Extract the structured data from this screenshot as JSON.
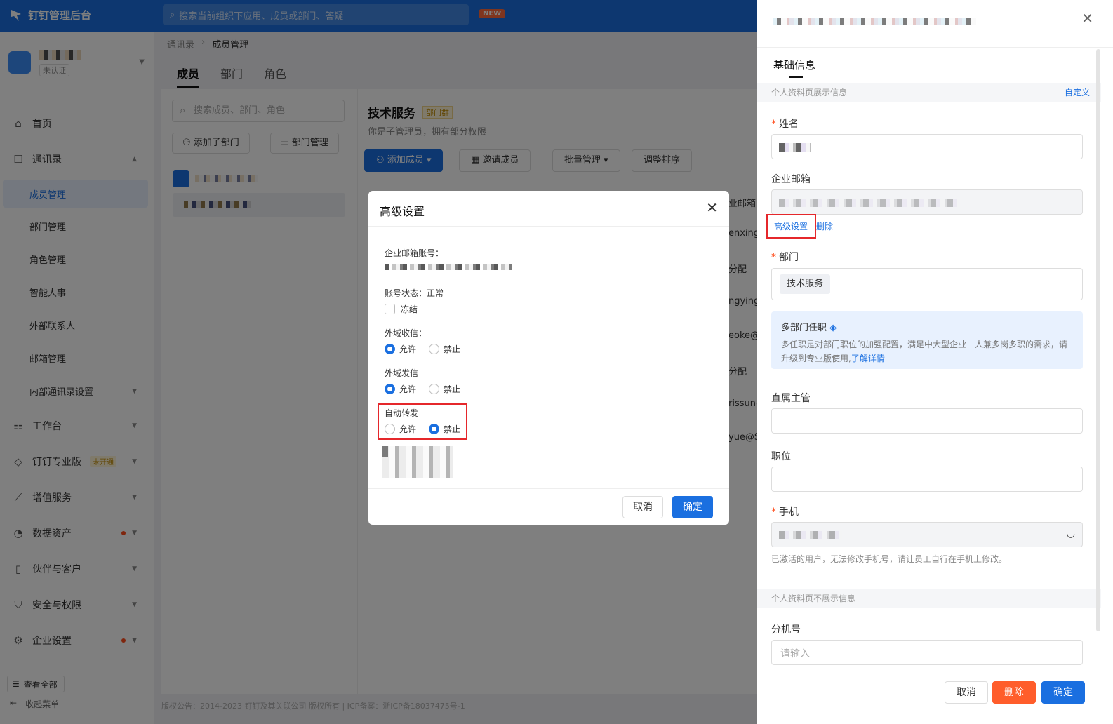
{
  "app": {
    "title": "钉钉管理后台"
  },
  "search": {
    "placeholder": "搜索当前组织下应用、成员或部门、答疑",
    "new_badge": "NEW"
  },
  "org": {
    "cert": "未认证"
  },
  "sidebar": {
    "home": "首页",
    "contacts": "通讯录",
    "contacts_sub": [
      "成员管理",
      "部门管理",
      "角色管理",
      "智能人事",
      "外部联系人",
      "邮箱管理",
      "内部通讯录设置"
    ],
    "sections": [
      {
        "label": "工作台"
      },
      {
        "label": "钉钉专业版",
        "tag": "未开通"
      },
      {
        "label": "增值服务"
      },
      {
        "label": "数据资产"
      },
      {
        "label": "伙伴与客户"
      },
      {
        "label": "安全与权限"
      },
      {
        "label": "企业设置"
      }
    ],
    "view_all": "查看全部",
    "collapse": "收起菜单"
  },
  "breadcrumb": {
    "root": "通讯录",
    "current": "成员管理"
  },
  "tabs": [
    "成员",
    "部门",
    "角色"
  ],
  "tree": {
    "search_placeholder": "搜索成员、部门、角色",
    "add_sub_dept": "添加子部门",
    "dept_manage": "部门管理"
  },
  "dept": {
    "title": "技术服务",
    "tag": "部门群",
    "subtitle": "你是子管理员，拥有部分权限",
    "add_member": "添加成员",
    "invite": "邀请成员",
    "batch": "批量管理",
    "sort": "调整排序",
    "peeks": [
      "业邮箱",
      "enxing",
      "分配",
      "ngying",
      "eoke@",
      "分配",
      "rissun@",
      "yue@S"
    ]
  },
  "footer": {
    "copyright": "版权公告：2014-2023 钉钉及其关联公司 版权所有 | ICP备案：浙ICP备18037475号-1"
  },
  "modal": {
    "title": "高级设置",
    "email_label": "企业邮箱账号：",
    "status_label": "账号状态：正常",
    "freeze": "冻结",
    "ext_recv": "外域收信：",
    "ext_send": "外域发信",
    "auto_forward": "自动转发",
    "allow": "允许",
    "deny": "禁止",
    "cancel": "取消",
    "confirm": "确定"
  },
  "drawer": {
    "tab": "基础信息",
    "section_shown": "个人资料页展示信息",
    "customize": "自定义",
    "name_label": "姓名",
    "email_label": "企业邮箱",
    "advanced": "高级设置",
    "delete_link": "删除",
    "dept_label": "部门",
    "dept_value": "技术服务",
    "multi_title": "多部门任职",
    "multi_desc": "多任职是对部门职位的加强配置，满足中大型企业一人兼多岗多职的需求，请升级到专业版使用,",
    "multi_link": "了解详情",
    "manager_label": "直属主管",
    "position_label": "职位",
    "phone_label": "手机",
    "phone_hint": "已激活的用户，无法修改手机号，请让员工自行在手机上修改。",
    "section_hidden": "个人资料页不展示信息",
    "ext_label": "分机号",
    "ext_placeholder": "请输入",
    "cancel": "取消",
    "delete": "删除",
    "confirm": "确定"
  },
  "colors": {
    "brand": "#1a6fe0",
    "danger": "#ff5d2b",
    "highlight": "#e5272b"
  }
}
